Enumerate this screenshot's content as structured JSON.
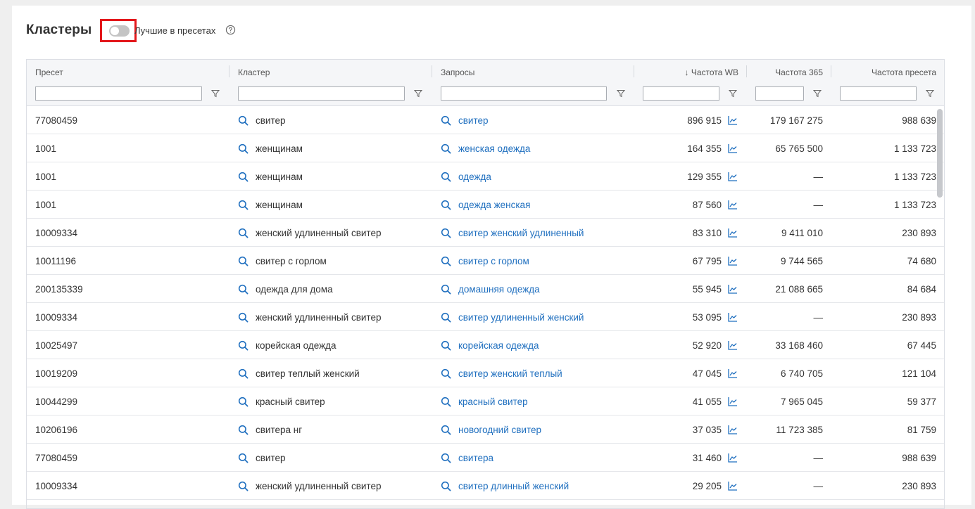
{
  "header": {
    "title": "Кластеры",
    "toggle_label": "Лучшие в пресетах"
  },
  "table": {
    "columns": {
      "preset": "Пресет",
      "cluster": "Кластер",
      "queries": "Запросы",
      "freq_wb": "↓ Частота WB",
      "freq_365": "Частота 365",
      "freq_preset": "Частота пресета"
    },
    "rows": [
      {
        "preset": "77080459",
        "cluster": "свитер",
        "query": "свитер",
        "freq_wb": "896 915",
        "freq_365": "179 167 275",
        "freq_preset": "988 639"
      },
      {
        "preset": "1001",
        "cluster": "женщинам",
        "query": "женская одежда",
        "freq_wb": "164 355",
        "freq_365": "65 765 500",
        "freq_preset": "1 133 723"
      },
      {
        "preset": "1001",
        "cluster": "женщинам",
        "query": "одежда",
        "freq_wb": "129 355",
        "freq_365": "—",
        "freq_preset": "1 133 723"
      },
      {
        "preset": "1001",
        "cluster": "женщинам",
        "query": "одежда женская",
        "freq_wb": "87 560",
        "freq_365": "—",
        "freq_preset": "1 133 723"
      },
      {
        "preset": "10009334",
        "cluster": "женский удлиненный свитер",
        "query": "свитер женский удлиненный",
        "freq_wb": "83 310",
        "freq_365": "9 411 010",
        "freq_preset": "230 893"
      },
      {
        "preset": "10011196",
        "cluster": "свитер с горлом",
        "query": "свитер с горлом",
        "freq_wb": "67 795",
        "freq_365": "9 744 565",
        "freq_preset": "74 680"
      },
      {
        "preset": "200135339",
        "cluster": "одежда для дома",
        "query": "домашняя одежда",
        "freq_wb": "55 945",
        "freq_365": "21 088 665",
        "freq_preset": "84 684"
      },
      {
        "preset": "10009334",
        "cluster": "женский удлиненный свитер",
        "query": "свитер удлиненный женский",
        "freq_wb": "53 095",
        "freq_365": "—",
        "freq_preset": "230 893"
      },
      {
        "preset": "10025497",
        "cluster": "корейская одежда",
        "query": "корейская одежда",
        "freq_wb": "52 920",
        "freq_365": "33 168 460",
        "freq_preset": "67 445"
      },
      {
        "preset": "10019209",
        "cluster": "свитер теплый женский",
        "query": "свитер женский теплый",
        "freq_wb": "47 045",
        "freq_365": "6 740 705",
        "freq_preset": "121 104"
      },
      {
        "preset": "10044299",
        "cluster": "красный свитер",
        "query": "красный свитер",
        "freq_wb": "41 055",
        "freq_365": "7 965 045",
        "freq_preset": "59 377"
      },
      {
        "preset": "10206196",
        "cluster": "свитера нг",
        "query": "новогодний свитер",
        "freq_wb": "37 035",
        "freq_365": "11 723 385",
        "freq_preset": "81 759"
      },
      {
        "preset": "77080459",
        "cluster": "свитер",
        "query": "свитера",
        "freq_wb": "31 460",
        "freq_365": "—",
        "freq_preset": "988 639"
      },
      {
        "preset": "10009334",
        "cluster": "женский удлиненный свитер",
        "query": "свитер длинный женский",
        "freq_wb": "29 205",
        "freq_365": "—",
        "freq_preset": "230 893"
      }
    ]
  },
  "colors": {
    "accent_link": "#1f6fbf",
    "highlight_border": "#e3171b",
    "toggle_off": "#c4c4c4"
  },
  "icons": {
    "help": "help-circle-icon",
    "filter": "filter-icon",
    "search": "search-icon",
    "chart": "chart-line-icon"
  }
}
